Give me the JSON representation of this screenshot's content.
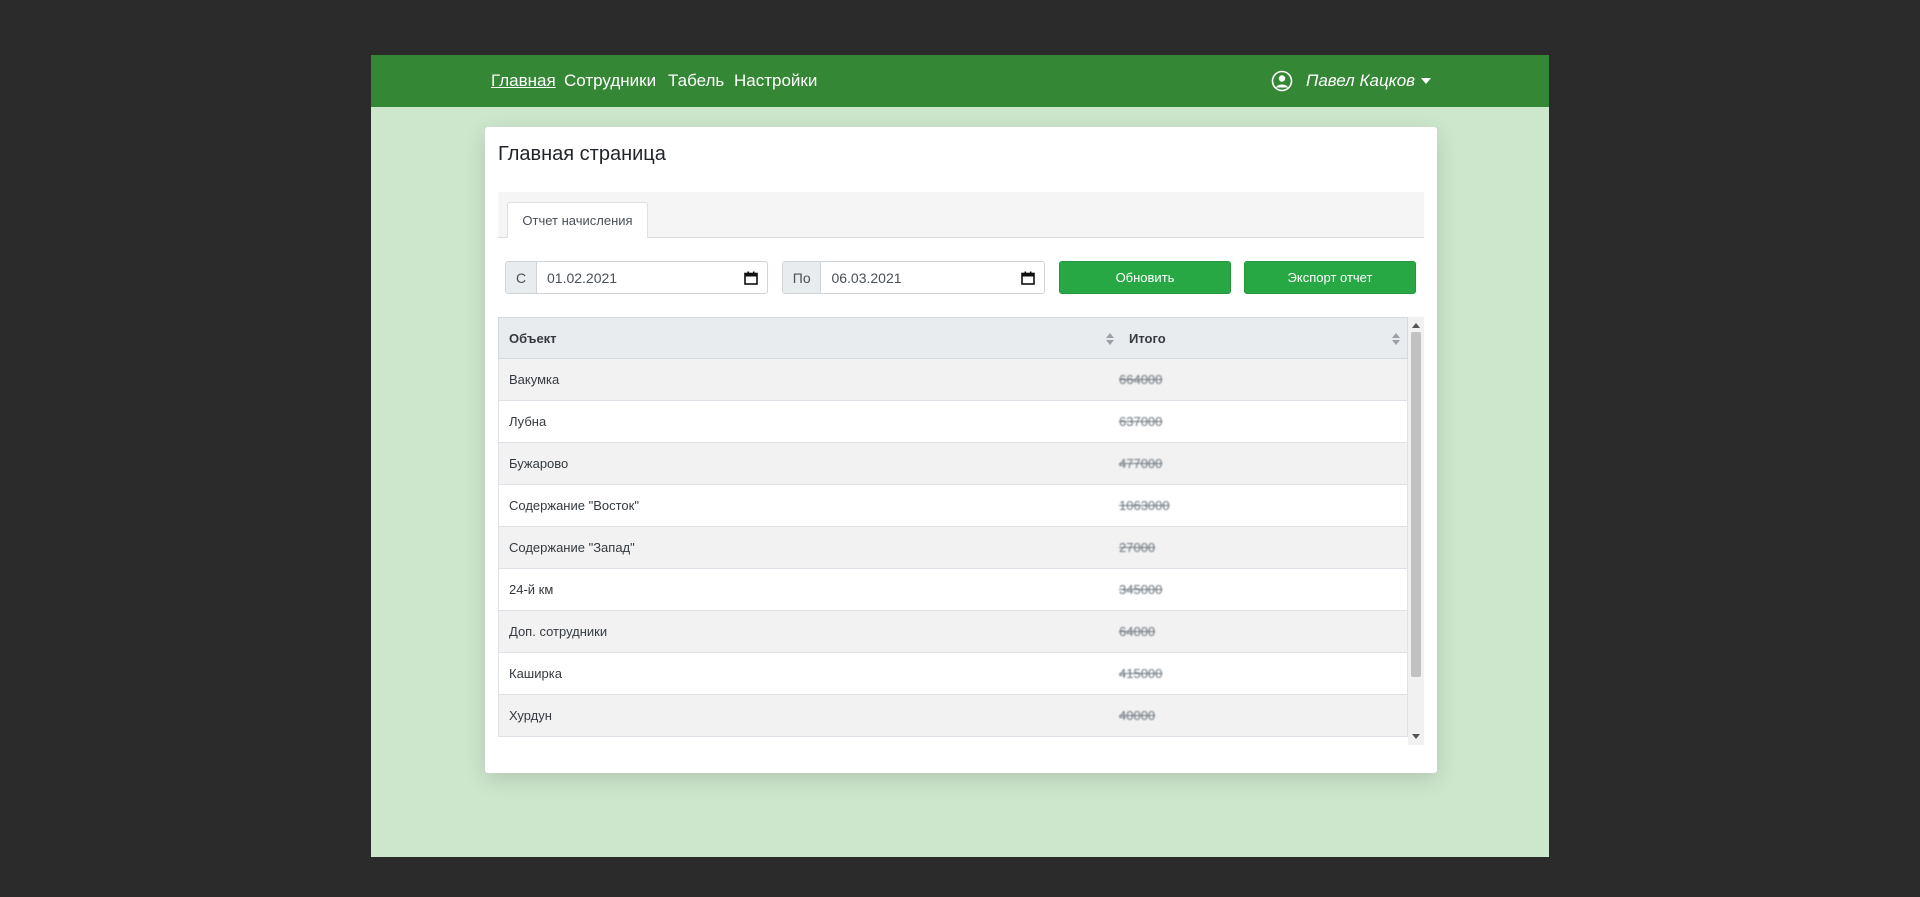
{
  "nav": {
    "links": [
      "Главная",
      "Сотрудники",
      "Табель",
      "Настройки"
    ],
    "active": "Главная",
    "user_name": "Павел Кацков",
    "user_icon": "user-circle-icon"
  },
  "page": {
    "title": "Главная страница",
    "tab": "Отчет начисления"
  },
  "filters": {
    "from_label": "С",
    "from_value": "01.02.2021",
    "to_label": "По",
    "to_value": "06.03.2021",
    "calendar_icon": "calendar-icon"
  },
  "buttons": {
    "refresh": "Обновить",
    "export": "Экспорт отчет"
  },
  "table": {
    "headers": [
      "Объект",
      "Итого"
    ],
    "rows": [
      {
        "object": "Вакумка",
        "total": "664000"
      },
      {
        "object": "Лубна",
        "total": "637000"
      },
      {
        "object": "Бужарово",
        "total": "477000"
      },
      {
        "object": "Содержание \"Восток\"",
        "total": "1063000"
      },
      {
        "object": "Содержание \"Запад\"",
        "total": "27000"
      },
      {
        "object": "24-й км",
        "total": "345000"
      },
      {
        "object": "Доп. сотрудники",
        "total": "64000"
      },
      {
        "object": "Каширка",
        "total": "415000"
      },
      {
        "object": "Хурдун",
        "total": "40000"
      }
    ]
  },
  "colors": {
    "navbar": "#348734",
    "background": "#cde7cd",
    "button": "#28a745"
  }
}
